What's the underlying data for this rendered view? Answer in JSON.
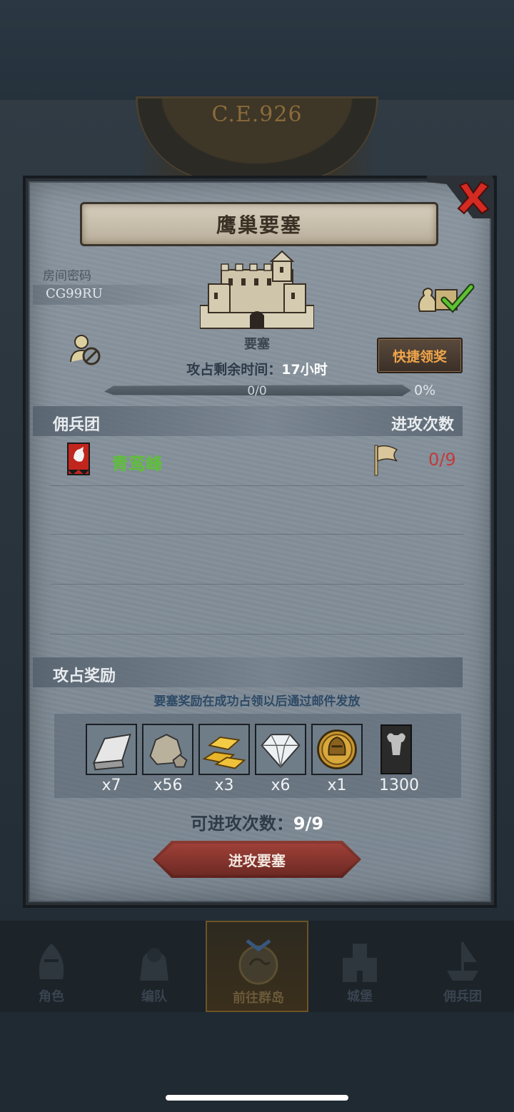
{
  "background": {
    "era_text": "C.E.926"
  },
  "modal": {
    "title": "鹰巢要塞",
    "room_password_label": "房间密码",
    "room_password_value": "CG99RU",
    "fortress_label": "要塞",
    "timer_label": "攻占剩余时间：",
    "timer_value": "17小时",
    "quick_claim_label": "快捷领奖",
    "progress": {
      "text": "0/0",
      "percent_text": "0%",
      "fraction": 0
    }
  },
  "mercenary_section": {
    "title": "佣兵团",
    "attack_count_header": "进攻次数",
    "rows": [
      {
        "name": "青鸾峰",
        "attacks": "0/9"
      }
    ]
  },
  "rewards_section": {
    "title": "攻占奖励",
    "note": "要塞奖励在成功占领以后通过邮件发放",
    "items": [
      {
        "icon": "iron-ingot-icon",
        "qty": "x7"
      },
      {
        "icon": "stone-icon",
        "qty": "x56"
      },
      {
        "icon": "gold-bars-icon",
        "qty": "x3"
      },
      {
        "icon": "diamond-icon",
        "qty": "x6"
      },
      {
        "icon": "knight-coin-icon",
        "qty": "x1"
      },
      {
        "icon": "bull-banner-icon",
        "qty": "1300"
      }
    ],
    "attempts_label": "可进攻次数：",
    "attempts_value": "9/9",
    "attack_button_label": "进攻要塞"
  },
  "bottom_nav": {
    "items": [
      {
        "label": "角色",
        "active": false
      },
      {
        "label": "编队",
        "active": false
      },
      {
        "label": "前往群岛",
        "active": true
      },
      {
        "label": "城堡",
        "active": false
      },
      {
        "label": "佣兵团",
        "active": false
      }
    ]
  },
  "colors": {
    "accent_gold": "#f0a64a",
    "merc_green": "#5fbf3a",
    "attack_red": "#c03b3b"
  }
}
